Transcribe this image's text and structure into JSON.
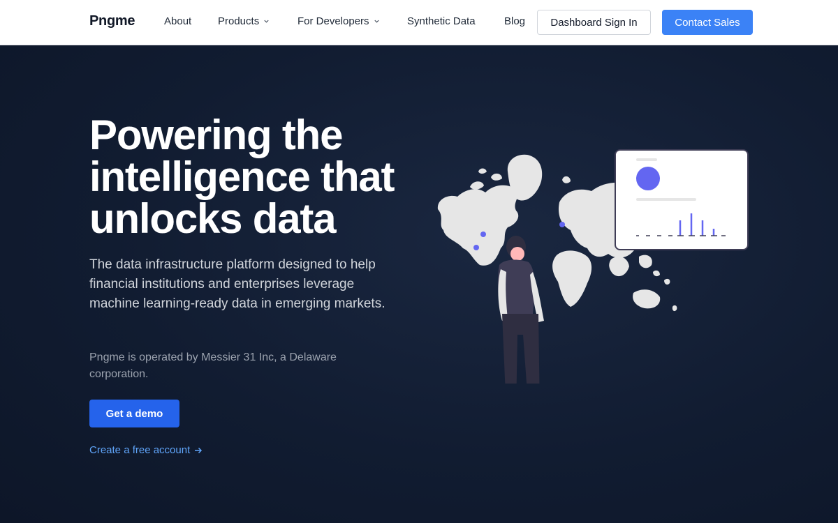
{
  "header": {
    "logo": "Pngme",
    "nav": [
      {
        "label": "About"
      },
      {
        "label": "Products"
      },
      {
        "label": "For Developers"
      },
      {
        "label": "Synthetic Data"
      },
      {
        "label": "Blog"
      }
    ],
    "signin_label": "Dashboard Sign In",
    "contact_label": "Contact Sales"
  },
  "hero": {
    "title_line1": "Powering the",
    "title_line2": "intelligence that",
    "title_line3": "unlocks data",
    "subtitle": "The data infrastructure platform designed to help financial institutions and enterprises leverage machine learning-ready data in emerging markets.",
    "note": "Pngme is operated by Messier 31 Inc, a Delaware corporation.",
    "demo_label": "Get a demo",
    "free_account_label": "Create a free account"
  },
  "colors": {
    "accent": "#3b82f6",
    "demo_button": "#2563eb",
    "link": "#60a5fa",
    "hero_bg": "#111c31",
    "illustration_accent": "#6366f1"
  },
  "icons": {
    "chevron": "chevron-down-icon",
    "arrow": "arrow-right-icon"
  }
}
